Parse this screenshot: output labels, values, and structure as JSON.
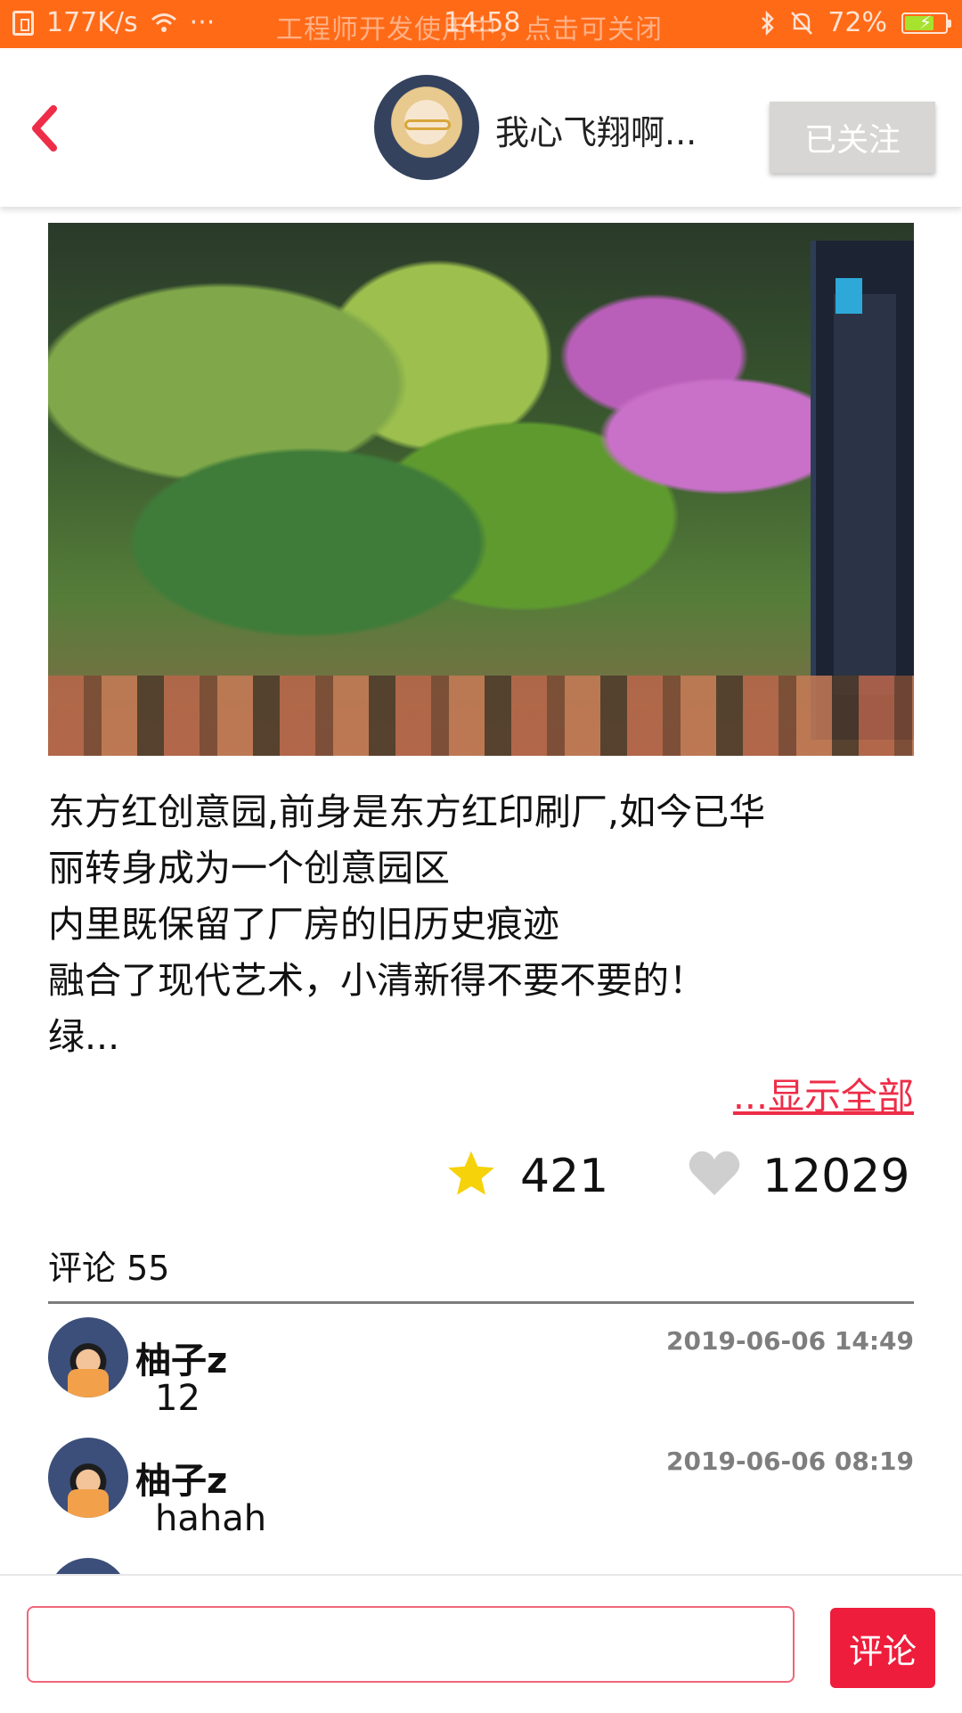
{
  "status_bar": {
    "speed": "177K/s",
    "dots": "···",
    "notice": "工程师开发使用中，点击可关闭",
    "time": "14:58",
    "battery_percent": "72%",
    "battery_level": 0.72
  },
  "header": {
    "author_name": "我心飞翔啊...",
    "follow_label": "已关注"
  },
  "post": {
    "text_lines": [
      "东方红创意园,前身是东方红印刷厂,如今已华",
      "丽转身成为一个创意园区",
      "内里既保留了厂房的旧历史痕迹",
      "融合了现代艺术，小清新得不要不要的！",
      "绿..."
    ],
    "show_all_label": "...显示全部",
    "favorites": "421",
    "likes": "12029"
  },
  "comments": {
    "title": "评论 55",
    "items": [
      {
        "name": "柚子z",
        "text": "12",
        "time": "2019-06-06 14:49"
      },
      {
        "name": "柚子z",
        "text": "hahah",
        "time": "2019-06-06 08:19"
      }
    ]
  },
  "composer": {
    "input_value": "",
    "submit_label": "评论"
  },
  "colors": {
    "status_bar": "#ff6a17",
    "accent": "#ee1d3b",
    "star": "#f5d20a",
    "heart": "#cfcfcf",
    "follow_button": "#d8d6d4"
  }
}
